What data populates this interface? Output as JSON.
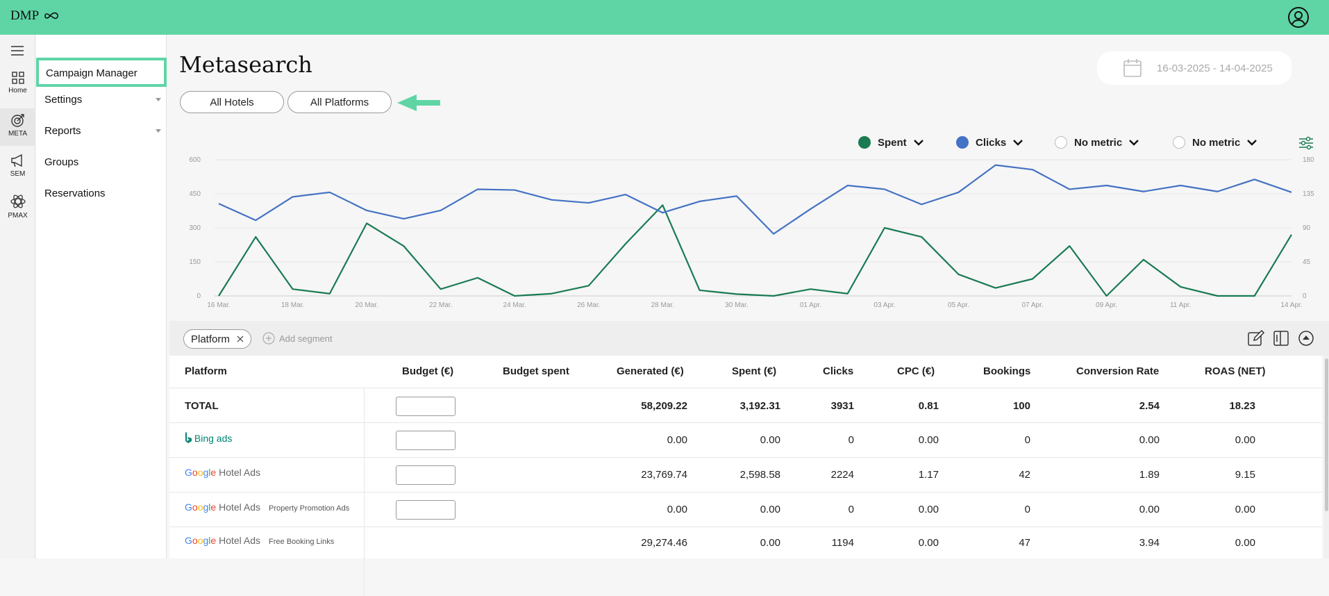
{
  "app": {
    "logo_text": "DMP"
  },
  "rail": [
    {
      "label": "Home",
      "icon": "grid-icon"
    },
    {
      "label": "META",
      "icon": "target-icon"
    },
    {
      "label": "SEM",
      "icon": "megaphone-icon"
    },
    {
      "label": "PMAX",
      "icon": "atom-icon"
    }
  ],
  "subnav": {
    "items": [
      {
        "label": "Campaign Manager",
        "active": true
      },
      {
        "label": "Settings",
        "has_caret": true
      },
      {
        "label": "Reports",
        "has_caret": true
      },
      {
        "label": "Groups"
      },
      {
        "label": "Reservations"
      }
    ]
  },
  "page": {
    "title": "Metasearch",
    "date_range": "16-03-2025 - 14-04-2025",
    "filters": {
      "hotels": "All Hotels",
      "platforms": "All Platforms"
    }
  },
  "metrics": [
    {
      "label": "Spent",
      "color": "#1a7a52",
      "filled": true
    },
    {
      "label": "Clicks",
      "color": "#4472c4",
      "filled": true
    },
    {
      "label": "No metric",
      "filled": false
    },
    {
      "label": "No metric",
      "filled": false
    }
  ],
  "chart_data": {
    "type": "line",
    "x": [
      "16 Mar.",
      "17 Mar.",
      "18 Mar.",
      "19 Mar.",
      "20 Mar.",
      "21 Mar.",
      "22 Mar.",
      "23 Mar.",
      "24 Mar.",
      "25 Mar.",
      "26 Mar.",
      "27 Mar.",
      "28 Mar.",
      "29 Mar.",
      "30 Mar.",
      "31 Mar.",
      "01 Apr.",
      "02 Apr.",
      "03 Apr.",
      "04 Apr.",
      "05 Apr.",
      "06 Apr.",
      "07 Apr.",
      "08 Apr.",
      "09 Apr.",
      "10 Apr.",
      "11 Apr.",
      "12 Apr.",
      "13 Apr.",
      "14 Apr."
    ],
    "xticks": [
      "16 Mar.",
      "18 Mar.",
      "20 Mar.",
      "22 Mar.",
      "24 Mar.",
      "26 Mar.",
      "28 Mar.",
      "30 Mar.",
      "01 Apr.",
      "03 Apr.",
      "05 Apr.",
      "07 Apr.",
      "09 Apr.",
      "11 Apr.",
      "14 Apr."
    ],
    "series": [
      {
        "name": "Spent",
        "axis": "left",
        "color": "#1a7a52",
        "values": [
          0,
          260,
          30,
          10,
          320,
          220,
          30,
          80,
          0,
          10,
          45,
          230,
          400,
          25,
          8,
          0,
          30,
          10,
          300,
          260,
          95,
          35,
          75,
          220,
          0,
          160,
          40,
          0,
          0,
          270
        ]
      },
      {
        "name": "Clicks",
        "axis": "right",
        "color": "#4472c4",
        "values": [
          122,
          100,
          131,
          137,
          113,
          102,
          113,
          141,
          140,
          127,
          123,
          134,
          110,
          125,
          132,
          82,
          115,
          146,
          141,
          121,
          137,
          173,
          167,
          141,
          146,
          138,
          146,
          138,
          154,
          137
        ]
      }
    ],
    "ylim_left": [
      0,
      600
    ],
    "yticks_left": [
      0,
      150,
      300,
      450,
      600
    ],
    "ylim_right": [
      0,
      180
    ],
    "yticks_right": [
      0,
      45,
      90,
      135,
      180
    ],
    "grid": true
  },
  "segments": {
    "chip": "Platform",
    "add_label": "Add segment"
  },
  "table": {
    "headers": [
      "Platform",
      "Budget (€)",
      "Budget spent",
      "Generated (€)",
      "Spent (€)",
      "Clicks",
      "CPC (€)",
      "Bookings",
      "Conversion Rate",
      "ROAS (NET)"
    ],
    "rows": [
      {
        "platform": "TOTAL",
        "has_input": true,
        "generated": "58,209.22",
        "spent": "3,192.31",
        "clicks": "3931",
        "cpc": "0.81",
        "bookings": "100",
        "cr": "2.54",
        "roas": "18.23"
      },
      {
        "platform": "Bing ads",
        "has_input": true,
        "generated": "0.00",
        "spent": "0.00",
        "clicks": "0",
        "cpc": "0.00",
        "bookings": "0",
        "cr": "0.00",
        "roas": "0.00"
      },
      {
        "platform": "Hotel Ads",
        "sub": "",
        "has_input": true,
        "generated": "23,769.74",
        "spent": "2,598.58",
        "clicks": "2224",
        "cpc": "1.17",
        "bookings": "42",
        "cr": "1.89",
        "roas": "9.15"
      },
      {
        "platform": "Hotel Ads",
        "sub": "Property Promotion Ads",
        "has_input": true,
        "generated": "0.00",
        "spent": "0.00",
        "clicks": "0",
        "cpc": "0.00",
        "bookings": "0",
        "cr": "0.00",
        "roas": "0.00"
      },
      {
        "platform": "Hotel Ads",
        "sub": "Free Booking Links",
        "has_input": false,
        "generated": "29,274.46",
        "spent": "0.00",
        "clicks": "1194",
        "cpc": "0.00",
        "bookings": "47",
        "cr": "3.94",
        "roas": "0.00"
      }
    ]
  }
}
